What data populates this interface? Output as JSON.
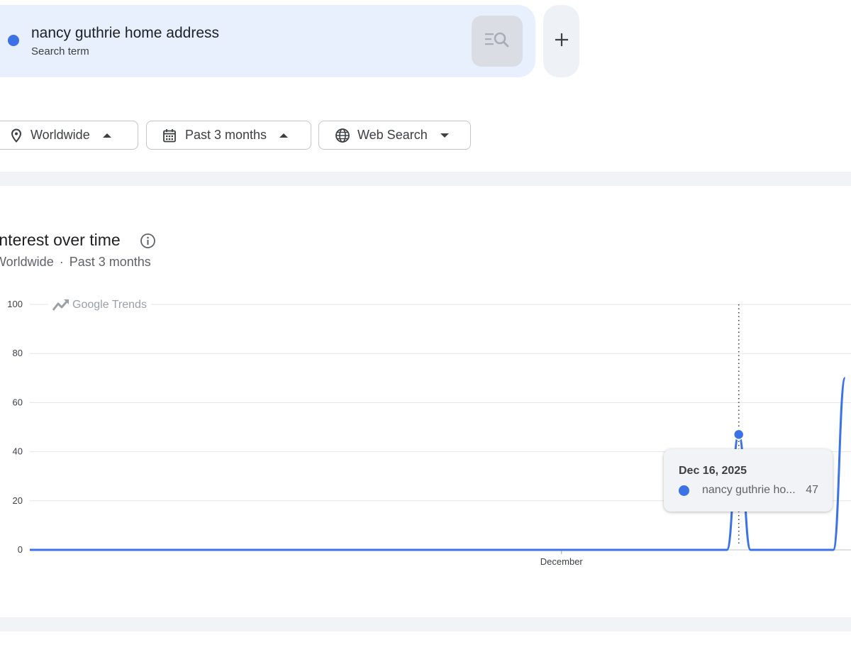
{
  "search": {
    "term": "nancy guthrie home address",
    "subtitle": "Search term",
    "term_color": "#3b73e6"
  },
  "icons": {
    "compare": "compare-search-icon",
    "add": "plus-icon",
    "region": "location-pin-icon",
    "time": "calendar-icon",
    "type": "globe-icon",
    "info": "info-icon",
    "brand": "google-trends-logo-icon"
  },
  "filters": {
    "region": "Worldwide",
    "time_range": "Past 3 months",
    "search_type": "Web Search"
  },
  "section": {
    "title": "Interest over time",
    "sub_region": "Worldwide",
    "sub_sep": "·",
    "sub_range": "Past 3 months"
  },
  "chart_data": {
    "type": "line",
    "watermark": "Google Trends",
    "y_ticks": [
      "100",
      "80",
      "60",
      "40",
      "20",
      "0"
    ],
    "x_tick_labels": [
      "December"
    ],
    "ylim": [
      0,
      100
    ],
    "grid": true,
    "series": [
      {
        "name": "nancy guthrie home address",
        "color": "#3b73e6",
        "points": [
          {
            "x": "Oct 17, 2025",
            "y": 0
          },
          {
            "x": "Dec 1, 2025",
            "y": 0
          },
          {
            "x": "Dec 15, 2025",
            "y": 0
          },
          {
            "x": "Dec 16, 2025",
            "y": 47
          },
          {
            "x": "Dec 17, 2025",
            "y": 0
          },
          {
            "x": "Dec 24, 2025",
            "y": 0
          },
          {
            "x": "Dec 25, 2025",
            "y": 70
          }
        ]
      }
    ],
    "highlight": {
      "date": "Dec 16, 2025",
      "series_label": "nancy guthrie ho...",
      "value": "47"
    }
  }
}
